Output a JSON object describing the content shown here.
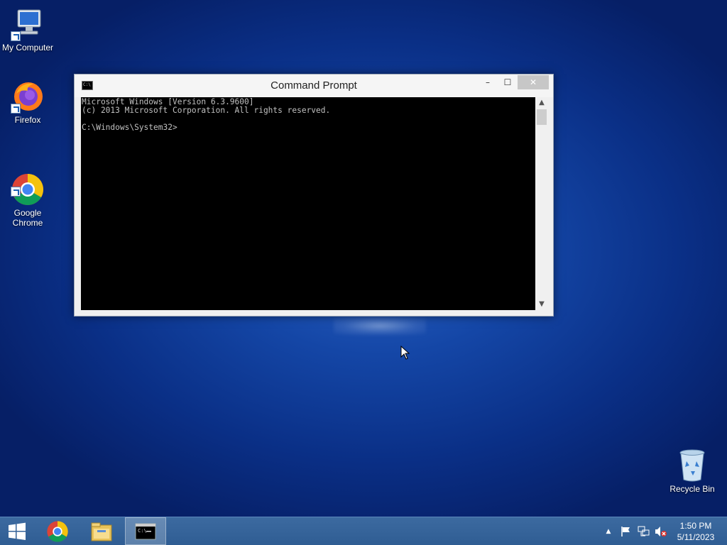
{
  "desktop": {
    "icons": [
      {
        "label": "My Computer"
      },
      {
        "label": "Firefox"
      },
      {
        "label": "Google\nChrome"
      },
      {
        "label": "Recycle Bin"
      }
    ]
  },
  "window": {
    "title": "Command Prompt",
    "icon_text": "C:\\",
    "minimize_label": "–",
    "maximize_label": "☐",
    "close_label": "✕",
    "console_lines": [
      "Microsoft Windows [Version 6.3.9600]",
      "(c) 2013 Microsoft Corporation. All rights reserved.",
      "",
      "C:\\Windows\\System32>"
    ]
  },
  "taskbar": {
    "items": [
      {
        "icon": "windows-start-icon"
      },
      {
        "icon": "chrome-icon"
      },
      {
        "icon": "file-explorer-icon"
      },
      {
        "icon": "command-prompt-icon",
        "active": true
      }
    ],
    "tray": {
      "icons": [
        "show-hidden-icons-icon",
        "action-center-flag-icon",
        "network-icon",
        "volume-muted-icon"
      ],
      "time": "1:50 PM",
      "date": "5/11/2023"
    }
  }
}
